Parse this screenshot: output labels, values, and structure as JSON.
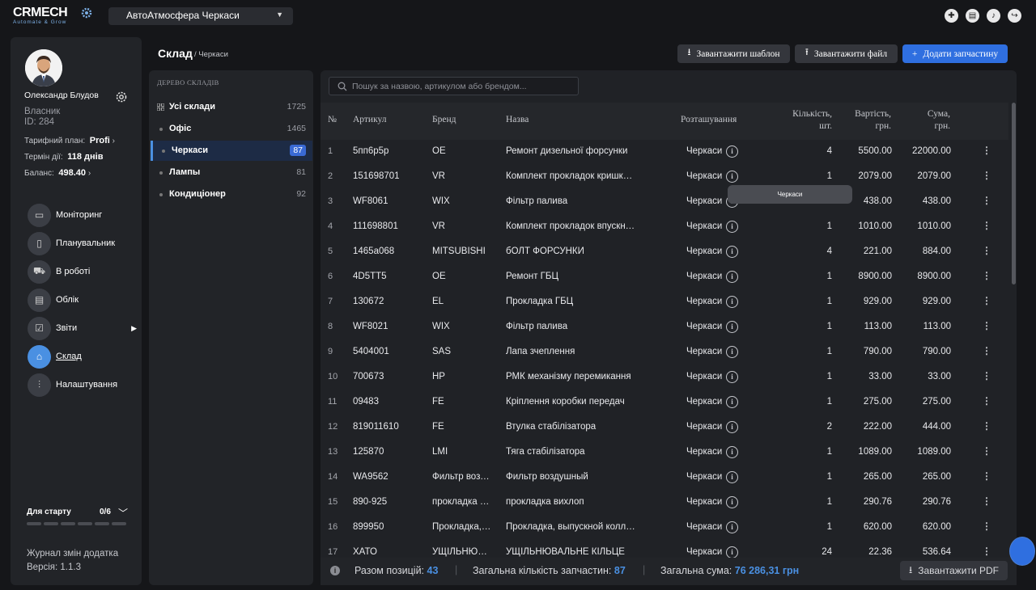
{
  "app": {
    "logo_text": "CRMECH",
    "logo_tagline": "Automate & Grow"
  },
  "header": {
    "company": "АвтоАтмосфера Черкаси"
  },
  "user": {
    "name": "Олександр Блудов",
    "role": "Власник",
    "id": "ID: 284",
    "plan_label": "Тарифний план:",
    "plan_value": "Profi",
    "term_label": "Термін дії:",
    "term_value": "118 днів",
    "balance_label": "Баланс:",
    "balance_value": "498.40"
  },
  "nav": [
    {
      "label": "Моніторинг",
      "icon": "camera-icon"
    },
    {
      "label": "Планувальник",
      "icon": "tablet-icon"
    },
    {
      "label": "В роботі",
      "icon": "car-icon"
    },
    {
      "label": "Облік",
      "icon": "document-icon"
    },
    {
      "label": "Звіти",
      "icon": "report-icon"
    },
    {
      "label": "Склад",
      "icon": "warehouse-icon"
    },
    {
      "label": "Налаштування",
      "icon": "sliders-icon"
    }
  ],
  "onboarding": {
    "label": "Для старту",
    "count": "0/6"
  },
  "footer_left": {
    "journal": "Журнал змін додатка",
    "version": "Версія: 1.1.3"
  },
  "page": {
    "title": "Склад",
    "breadcrumb": "/ Черкаси"
  },
  "actions": {
    "template": "Завантажити шаблон",
    "upload": "Завантажити файл",
    "add": "Додати запчастину"
  },
  "tree": {
    "heading": "ДЕРЕВО СКЛАДІВ",
    "items": [
      {
        "label": "Усі склади",
        "count": "1725"
      },
      {
        "label": "Офіс",
        "count": "1465"
      },
      {
        "label": "Черкаси",
        "count": "87"
      },
      {
        "label": "Лампы",
        "count": "81"
      },
      {
        "label": "Кондиціонер",
        "count": "92"
      }
    ]
  },
  "search": {
    "placeholder": "Пошук за назвою, артикулом або брендом..."
  },
  "table": {
    "headers": {
      "num": "№",
      "article": "Артикул",
      "brand": "Бренд",
      "name": "Назва",
      "location": "Розташування",
      "qty1": "Кількість,",
      "qty2": "шт.",
      "price1": "Вартість,",
      "price2": "грн.",
      "sum1": "Сума,",
      "sum2": "грн."
    },
    "rows": [
      [
        "1",
        "5пп6р5р",
        "OE",
        "Ремонт дизельної форсунки",
        "Черкаси",
        "4",
        "5500.00",
        "22000.00"
      ],
      [
        "2",
        "151698701",
        "VR",
        "Комплект прокладок кришки клапанів",
        "Черкаси",
        "1",
        "2079.00",
        "2079.00"
      ],
      [
        "3",
        "WF8061",
        "WIX",
        "Фільтр палива",
        "Черкаси",
        "1",
        "438.00",
        "438.00"
      ],
      [
        "4",
        "111698801",
        "VR",
        "Комплект прокладок впускного колектора",
        "Черкаси",
        "1",
        "1010.00",
        "1010.00"
      ],
      [
        "5",
        "1465a068",
        "MITSUBISHI",
        "бОЛТ ФОРСУНКИ",
        "Черкаси",
        "4",
        "221.00",
        "884.00"
      ],
      [
        "6",
        "4D5TT5",
        "OE",
        "Ремонт ГБЦ",
        "Черкаси",
        "1",
        "8900.00",
        "8900.00"
      ],
      [
        "7",
        "130672",
        "EL",
        "Прокладка ГБЦ",
        "Черкаси",
        "1",
        "929.00",
        "929.00"
      ],
      [
        "8",
        "WF8021",
        "WIX",
        "Фільтр палива",
        "Черкаси",
        "1",
        "113.00",
        "113.00"
      ],
      [
        "9",
        "5404001",
        "SAS",
        "Лапа зчеплення",
        "Черкаси",
        "1",
        "790.00",
        "790.00"
      ],
      [
        "10",
        "700673",
        "HP",
        "РМК механізму перемикання",
        "Черкаси",
        "1",
        "33.00",
        "33.00"
      ],
      [
        "11",
        "09483",
        "FE",
        "Кріплення коробки передач",
        "Черкаси",
        "1",
        "275.00",
        "275.00"
      ],
      [
        "12",
        "819011610",
        "FE",
        "Втулка стабілізатора",
        "Черкаси",
        "2",
        "222.00",
        "444.00"
      ],
      [
        "13",
        "125870",
        "LMI",
        "Тяга стабілізатора",
        "Черкаси",
        "1",
        "1089.00",
        "1089.00"
      ],
      [
        "14",
        "WA9562",
        "Фильтр воздушный",
        "Фильтр воздушный",
        "Черкаси",
        "1",
        "265.00",
        "265.00"
      ],
      [
        "15",
        "890-925",
        "прокладка вихлоп",
        "прокладка вихлоп",
        "Черкаси",
        "1",
        "290.76",
        "290.76"
      ],
      [
        "16",
        "899950",
        "Прокладка, выпускной коллектор",
        "Прокладка, выпускной коллектор",
        "Черкаси",
        "1",
        "620.00",
        "620.00"
      ],
      [
        "17",
        "ХАТО",
        "УЩІЛЬНЮВАЧ",
        "УЩІЛЬНЮВАЛЬНЕ КІЛЬЦЕ",
        "Черкаси",
        "24",
        "22.36",
        "536.64"
      ]
    ]
  },
  "tooltip": "Черкаси",
  "summary": {
    "positions_label": "Разом позицій:",
    "positions": "43",
    "qty_label": "Загальна кількість запчастин:",
    "qty": "87",
    "sum_label": "Загальна сума:",
    "sum": "76 286,31 грн"
  },
  "pdf_button": "Завантажити PDF",
  "colors": {
    "accent": "#4a90e2",
    "primary_button": "#2f6fe0",
    "background": "#151619",
    "panel": "#222428"
  }
}
